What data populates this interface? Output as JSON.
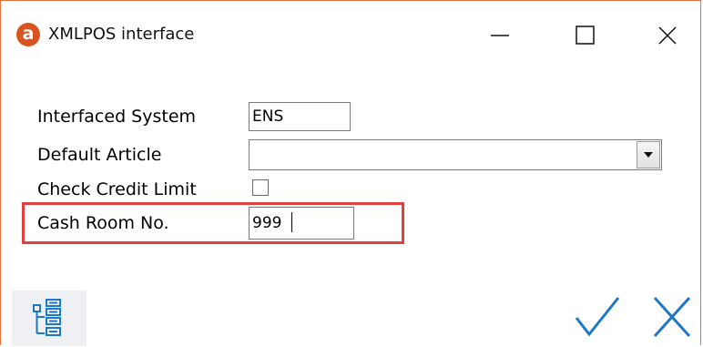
{
  "window": {
    "title": "XMLPOS interface",
    "app_icon_letter": "a",
    "border_color": "#e8713c",
    "accent_color": "#1e78c8"
  },
  "titlebar_buttons": [
    {
      "name": "minimize-icon"
    },
    {
      "name": "maximize-icon"
    },
    {
      "name": "close-icon"
    }
  ],
  "form": {
    "interfaced_system": {
      "label": "Interfaced System",
      "value": "ENS"
    },
    "default_article": {
      "label": "Default Article",
      "value": ""
    },
    "check_credit_limit": {
      "label": "Check Credit Limit",
      "checked": false
    },
    "cash_room_no": {
      "label": "Cash Room No.",
      "value": "999"
    }
  },
  "highlight": {
    "color": "#e0403e",
    "target": "cash_room_no"
  },
  "footer": {
    "tree_icon": "tree-view-icon",
    "ok_icon": "checkmark-icon",
    "cancel_icon": "x-icon"
  }
}
